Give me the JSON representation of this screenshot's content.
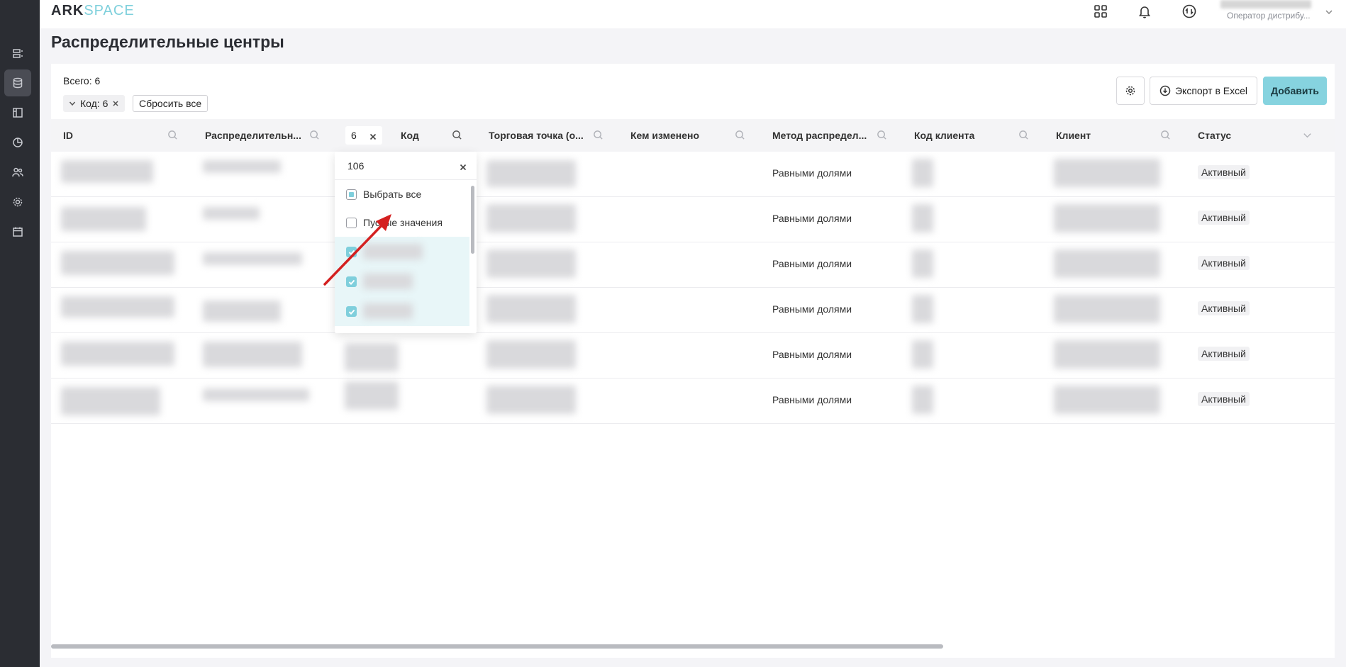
{
  "app": {
    "logo_ark": "ARK",
    "logo_space": "SPACE"
  },
  "topbar": {
    "user_role": "Оператор дистрибу..."
  },
  "page": {
    "title": "Распределительные центры"
  },
  "toolbar": {
    "total_label": "Всего: 6",
    "filter_chip": "Код: 6",
    "reset_label": "Сбросить все",
    "export_label": "Экспорт в Excel",
    "add_label": "Добавить"
  },
  "table": {
    "columns": [
      "ID",
      "Распределительн...",
      "Код",
      "Торговая точка (о...",
      "Кем изменено",
      "Метод распредел...",
      "Код клиента",
      "Клиент",
      "Статус"
    ],
    "rows": [
      {
        "method": "Равными долями",
        "status": "Активный"
      },
      {
        "method": "Равными долями",
        "status": "Активный"
      },
      {
        "method": "Равными долями",
        "status": "Активный"
      },
      {
        "method": "Равными долями",
        "status": "Активный"
      },
      {
        "method": "Равными долями",
        "status": "Активный"
      },
      {
        "method": "Равными долями",
        "status": "Активный"
      }
    ]
  },
  "filter": {
    "column_value": "6",
    "search_value": "106",
    "select_all": "Выбрать все",
    "empty_values": "Пустые значения"
  },
  "colors": {
    "accent": "#86d3df",
    "sidebar": "#2b2d33"
  }
}
